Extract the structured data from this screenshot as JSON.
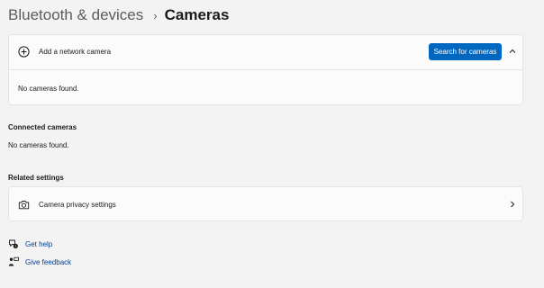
{
  "breadcrumb": {
    "parent": "Bluetooth & devices",
    "separator": "›",
    "current": "Cameras"
  },
  "network_camera": {
    "label": "Add a network camera",
    "icon": "add-circle-icon",
    "button_label": "Search for cameras",
    "expanded": true,
    "empty_text": "No cameras found."
  },
  "connected": {
    "title": "Connected cameras",
    "empty_text": "No cameras found."
  },
  "related": {
    "title": "Related settings",
    "privacy_label": "Camera privacy settings",
    "privacy_icon": "camera-icon"
  },
  "footer": {
    "help_label": "Get help",
    "feedback_label": "Give feedback"
  },
  "colors": {
    "accent": "#0067c0",
    "link": "#003e92",
    "background": "#f3f3f3",
    "card": "#fbfbfb"
  }
}
